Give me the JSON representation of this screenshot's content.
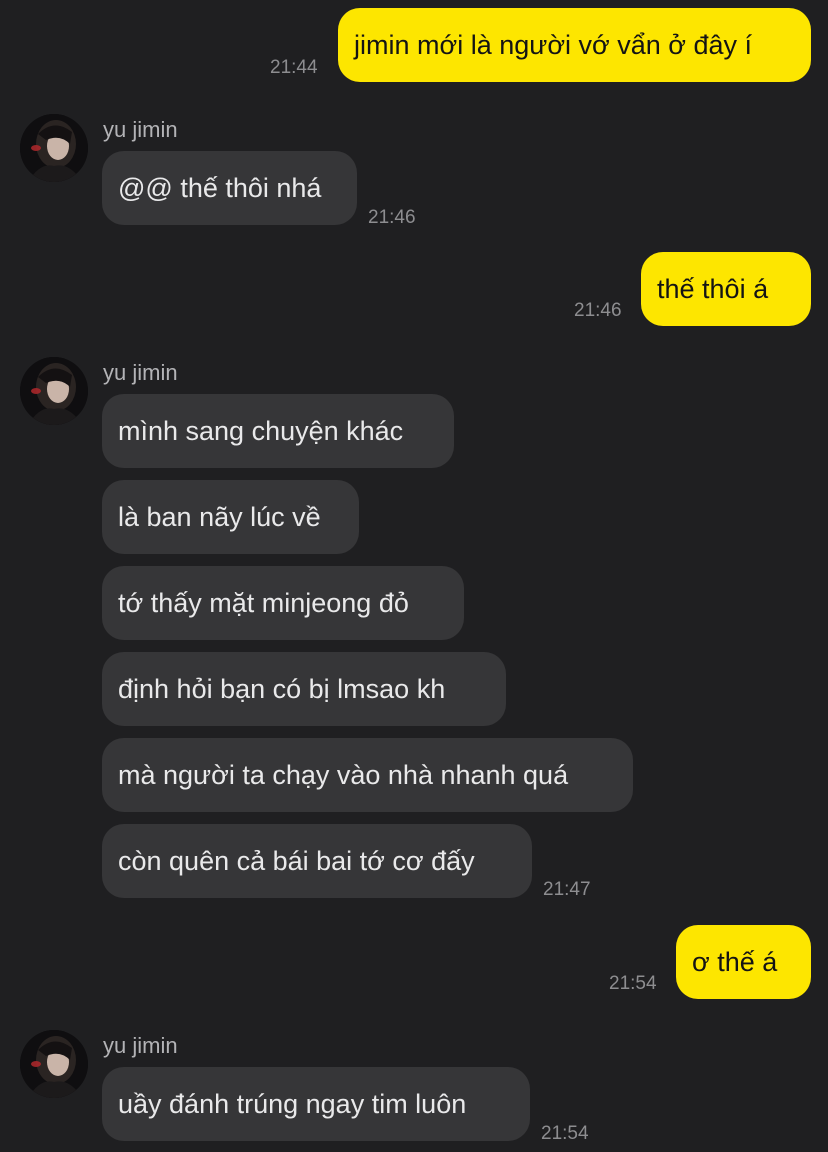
{
  "messages": [
    {
      "text": "jimin mới là người vớ vẩn ở đây í",
      "time": "21:44"
    },
    {
      "sender": "yu jimin",
      "text": "@@ thế thôi nhá",
      "time": "21:46"
    },
    {
      "text": "thế thôi á",
      "time": "21:46"
    },
    {
      "sender": "yu jimin",
      "lines": [
        "mình sang chuyện khác",
        "là ban nãy lúc về",
        "tớ thấy mặt minjeong đỏ",
        "định hỏi bạn có bị lmsao kh",
        "mà người ta chạy vào nhà nhanh quá",
        "còn quên cả bái bai tớ cơ đấy"
      ],
      "time": "21:47"
    },
    {
      "text": "ơ thế á",
      "time": "21:54"
    },
    {
      "sender": "yu jimin",
      "text": "uầy đánh trúng ngay tim luôn",
      "time": "21:54"
    }
  ],
  "colors": {
    "background": "#1f1f21",
    "outgoing_bubble": "#fde600",
    "incoming_bubble": "#363638"
  },
  "icons": {
    "avatar": "profile-photo-icon"
  }
}
